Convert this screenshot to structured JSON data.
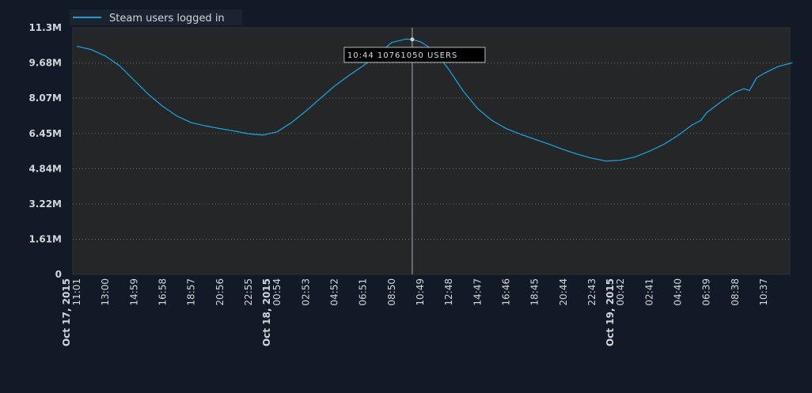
{
  "chart_data": {
    "type": "line",
    "title": "",
    "xlabel": "",
    "ylabel": "",
    "legend": {
      "position": "top-left",
      "label": "Steam users logged in"
    },
    "ylim": [
      0,
      11300000
    ],
    "grid": true,
    "colors": {
      "page_background": "#111a26",
      "plot_background": "#242628",
      "series": "#1b9ed8",
      "gridline": "#6a6e73",
      "crosshair": "#9fb0bc",
      "text": "#cfd6dc"
    },
    "y_ticks": [
      "0",
      "1.61M",
      "3.22M",
      "4.84M",
      "6.45M",
      "8.07M",
      "9.68M",
      "11.3M"
    ],
    "y_tick_values": [
      0,
      1610000,
      3220000,
      4840000,
      6450000,
      8070000,
      9680000,
      11300000
    ],
    "x_ticks": [
      "11:01",
      "13:00",
      "14:59",
      "16:58",
      "18:57",
      "20:56",
      "22:55",
      "00:54",
      "02:53",
      "04:52",
      "06:51",
      "08:50",
      "10:49",
      "12:48",
      "14:47",
      "16:46",
      "18:45",
      "20:44",
      "22:43",
      "00:42",
      "02:41",
      "04:40",
      "06:39",
      "08:38",
      "10:37"
    ],
    "date_ticks": [
      {
        "label": "Oct 17, 2015",
        "tick_index": 0
      },
      {
        "label": "Oct 18, 2015",
        "tick_index": 7
      },
      {
        "label": "Oct 19, 2015",
        "tick_index": 19
      }
    ],
    "tooltip": {
      "text": "10:44 10761050 USERS",
      "x": 11.72,
      "y": 10761050
    },
    "series": [
      {
        "name": "Steam users logged in",
        "points": [
          [
            0.0,
            10450000
          ],
          [
            0.5,
            10300000
          ],
          [
            1.0,
            10000000
          ],
          [
            1.5,
            9550000
          ],
          [
            2.0,
            8900000
          ],
          [
            2.5,
            8250000
          ],
          [
            3.0,
            7700000
          ],
          [
            3.5,
            7250000
          ],
          [
            4.0,
            6950000
          ],
          [
            4.5,
            6800000
          ],
          [
            5.0,
            6680000
          ],
          [
            5.5,
            6570000
          ],
          [
            6.0,
            6440000
          ],
          [
            6.5,
            6380000
          ],
          [
            7.0,
            6530000
          ],
          [
            7.5,
            6950000
          ],
          [
            8.0,
            7480000
          ],
          [
            8.5,
            8050000
          ],
          [
            9.0,
            8620000
          ],
          [
            9.5,
            9100000
          ],
          [
            10.0,
            9550000
          ],
          [
            10.5,
            10060000
          ],
          [
            11.0,
            10620000
          ],
          [
            11.5,
            10780000
          ],
          [
            11.72,
            10761050
          ],
          [
            12.0,
            10660000
          ],
          [
            12.5,
            10250000
          ],
          [
            13.0,
            9380000
          ],
          [
            13.5,
            8400000
          ],
          [
            14.0,
            7600000
          ],
          [
            14.5,
            7050000
          ],
          [
            15.0,
            6680000
          ],
          [
            15.5,
            6420000
          ],
          [
            16.0,
            6190000
          ],
          [
            16.5,
            5960000
          ],
          [
            17.0,
            5720000
          ],
          [
            17.5,
            5500000
          ],
          [
            18.0,
            5320000
          ],
          [
            18.5,
            5190000
          ],
          [
            19.0,
            5230000
          ],
          [
            19.5,
            5380000
          ],
          [
            20.0,
            5640000
          ],
          [
            20.5,
            5950000
          ],
          [
            21.0,
            6360000
          ],
          [
            21.5,
            6850000
          ],
          [
            21.8,
            7050000
          ],
          [
            22.0,
            7400000
          ],
          [
            22.5,
            7900000
          ],
          [
            23.0,
            8350000
          ],
          [
            23.3,
            8500000
          ],
          [
            23.5,
            8420000
          ],
          [
            23.75,
            9000000
          ],
          [
            24.0,
            9200000
          ],
          [
            24.5,
            9520000
          ],
          [
            25.0,
            9700000
          ]
        ]
      }
    ]
  }
}
